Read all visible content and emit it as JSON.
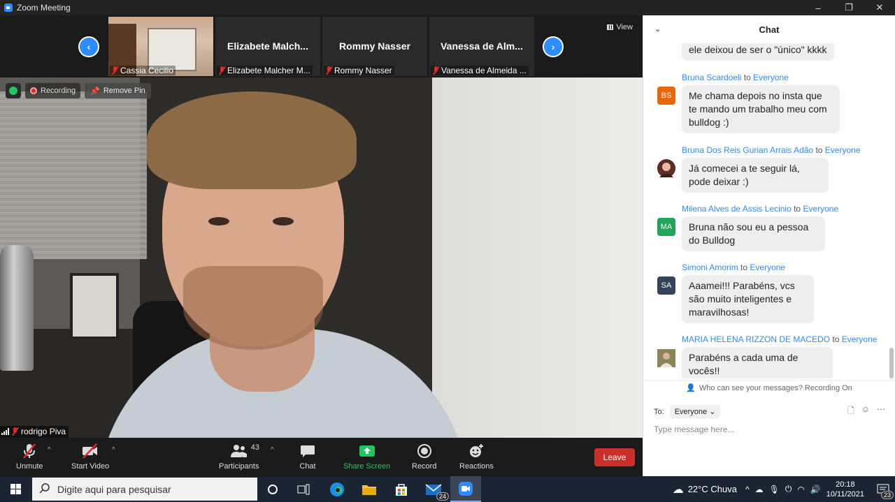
{
  "window": {
    "title": "Zoom Meeting",
    "controls": [
      "–",
      "❐",
      "✕"
    ]
  },
  "strip": {
    "view_label": "View",
    "tiles": [
      {
        "center_name": "",
        "footer": "Cassia Cecilio",
        "has_video": true
      },
      {
        "center_name": "Elizabete  Malch...",
        "footer": "Elizabete Malcher M..."
      },
      {
        "center_name": "Rommy Nasser",
        "footer": "Rommy Nasser"
      },
      {
        "center_name": "Vanessa de Alm...",
        "footer": "Vanessa de Almeida ..."
      }
    ]
  },
  "video": {
    "recording_label": "Recording",
    "remove_pin_label": "Remove Pin",
    "speaker_name": "rodrigo Piva"
  },
  "toolbar": {
    "unmute": "Unmute",
    "start_video": "Start Video",
    "participants": "Participants",
    "participants_count": "43",
    "chat": "Chat",
    "share_screen": "Share Screen",
    "record": "Record",
    "reactions": "Reactions",
    "leave": "Leave"
  },
  "chat": {
    "title": "Chat",
    "partial_message": "ele deixou de ser o \"único\" kkkk",
    "messages": [
      {
        "sender": "Bruna Scardoeli",
        "to_word": "to",
        "recipient": "Everyone",
        "initials": "BS",
        "avatar_color": "#e8670c",
        "text": "Me chama depois no insta que te mando um trabalho meu com bulldog :)"
      },
      {
        "sender": "Bruna Dos Reis Gurian Arrais Adão",
        "to_word": "to",
        "recipient": "Everyone",
        "initials": "",
        "avatar_color": "#7a4a3a",
        "text": "Já comecei a te seguir lá, pode deixar :)"
      },
      {
        "sender": "Milena Alves de Assis Lecinio",
        "to_word": "to",
        "recipient": "Everyone",
        "initials": "MA",
        "avatar_color": "#21a35a",
        "text": "Bruna não sou eu a pessoa do Bulldog"
      },
      {
        "sender": "Simoni Amorim",
        "to_word": "to",
        "recipient": "Everyone",
        "initials": "SA",
        "avatar_color": "#33445a",
        "text": "Aaamei!!! Parabéns, vcs são muito inteligentes e maravilhosas!"
      },
      {
        "sender": "MARIA HELENA RIZZON DE MACEDO",
        "to_word": "to",
        "recipient": "Everyone",
        "initials": "",
        "avatar_color": "#6d6a4a",
        "text": "Parabéns a cada uma de vocês!!"
      }
    ],
    "who_can_see": "Who can see your messages? Recording On",
    "to_label": "To:",
    "to_value": "Everyone",
    "input_placeholder": "Type message here..."
  },
  "taskbar": {
    "search_placeholder": "Digite aqui para pesquisar",
    "mail_badge": "24",
    "weather": "22°C  Chuva",
    "time": "20:18",
    "date": "10/11/2021",
    "notif_badge": "23"
  },
  "colors": {
    "accent": "#2d8cff",
    "leave": "#c9302c",
    "share": "#23c55e",
    "mic_off": "#e02828"
  }
}
